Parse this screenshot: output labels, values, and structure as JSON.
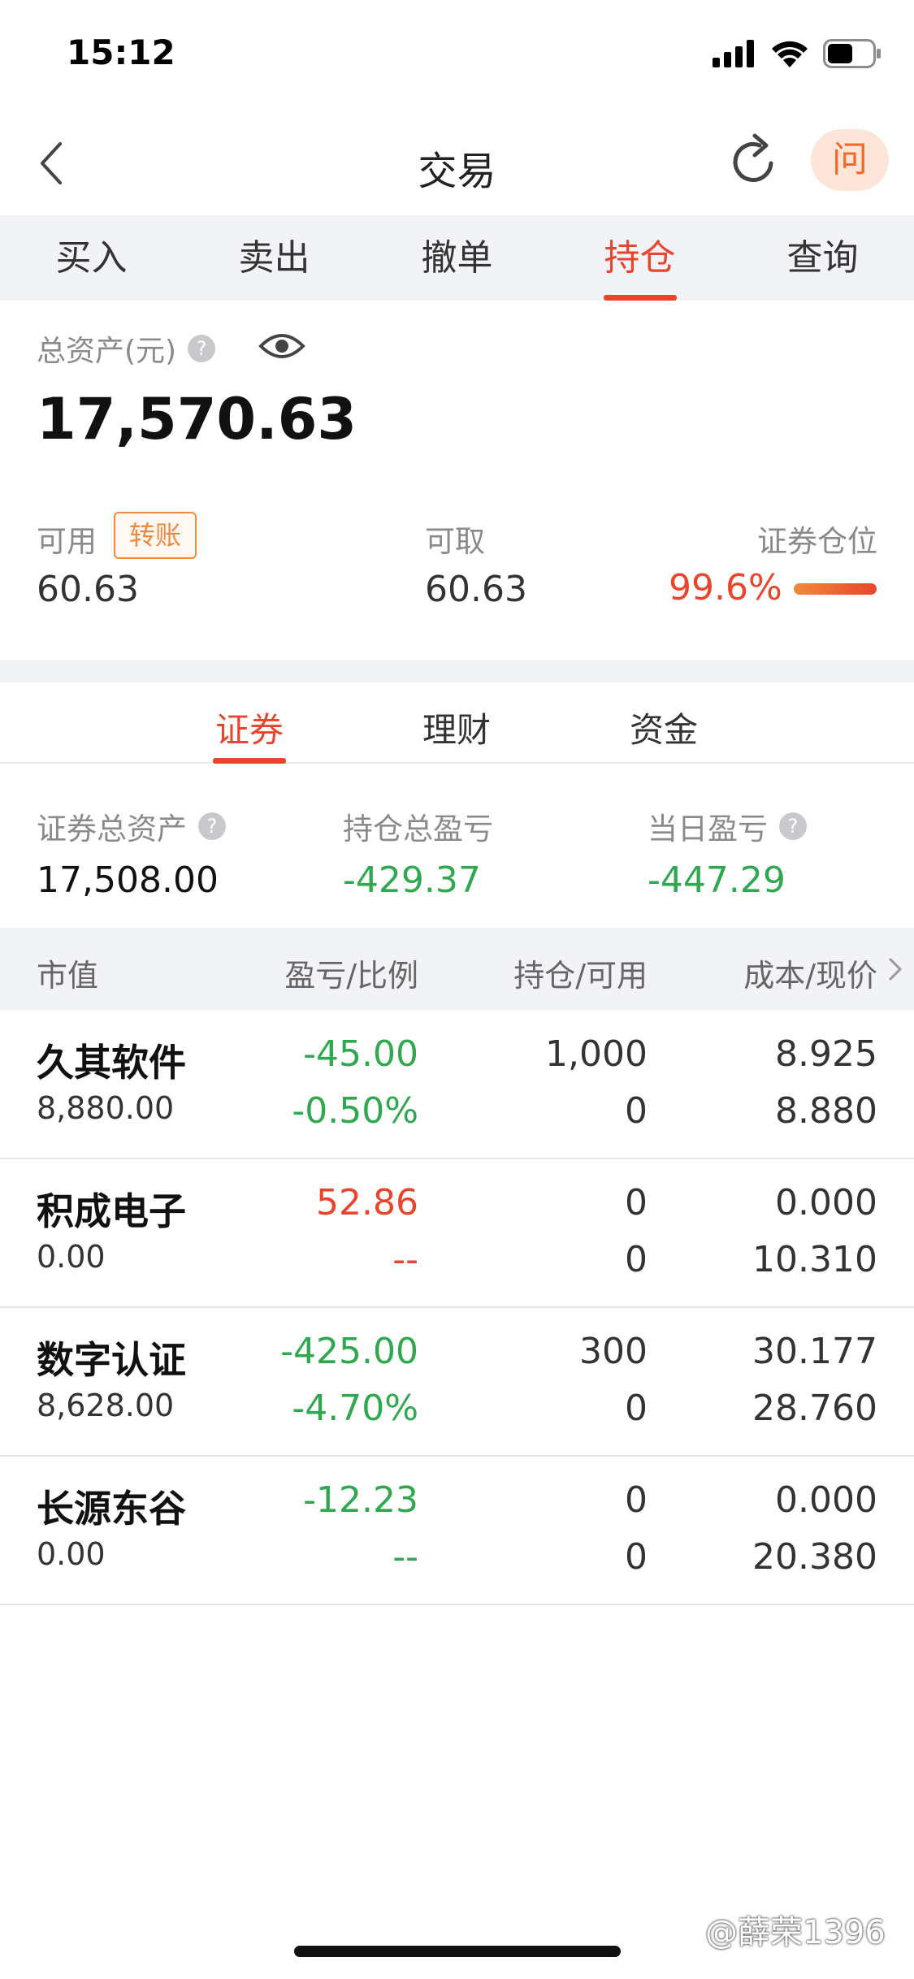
{
  "status": {
    "time": "15:12"
  },
  "nav": {
    "title": "交易",
    "help": "问"
  },
  "tabs": [
    "买入",
    "卖出",
    "撤单",
    "持仓",
    "查询"
  ],
  "assets": {
    "total_label": "总资产(元)",
    "total_value": "17,570.63",
    "available_label": "可用",
    "transfer_label": "转账",
    "available_value": "60.63",
    "withdrawable_label": "可取",
    "withdrawable_value": "60.63",
    "position_label": "证券仓位",
    "position_value": "99.6%"
  },
  "subtabs": [
    "证券",
    "理财",
    "资金"
  ],
  "stats": {
    "securities_total_label": "证券总资产",
    "securities_total_value": "17,508.00",
    "holding_pnl_label": "持仓总盈亏",
    "holding_pnl_value": "-429.37",
    "daily_pnl_label": "当日盈亏",
    "daily_pnl_value": "-447.29"
  },
  "table": {
    "headers": [
      "市值",
      "盈亏/比例",
      "持仓/可用",
      "成本/现价"
    ],
    "rows": [
      {
        "name": "久其软件",
        "market_value": "8,880.00",
        "pnl": "-45.00",
        "pnl_ratio": "-0.50%",
        "holding": "1,000",
        "available": "0",
        "cost": "8.925",
        "price": "8.880",
        "pnl_color": "green"
      },
      {
        "name": "积成电子",
        "market_value": "0.00",
        "pnl": "52.86",
        "pnl_ratio": "--",
        "holding": "0",
        "available": "0",
        "cost": "0.000",
        "price": "10.310",
        "pnl_color": "red"
      },
      {
        "name": "数字认证",
        "market_value": "8,628.00",
        "pnl": "-425.00",
        "pnl_ratio": "-4.70%",
        "holding": "300",
        "available": "0",
        "cost": "30.177",
        "price": "28.760",
        "pnl_color": "green"
      },
      {
        "name": "长源东谷",
        "market_value": "0.00",
        "pnl": "-12.23",
        "pnl_ratio": "--",
        "holding": "0",
        "available": "0",
        "cost": "0.000",
        "price": "20.380",
        "pnl_color": "green"
      }
    ]
  },
  "watermark": "@薛荣1396"
}
